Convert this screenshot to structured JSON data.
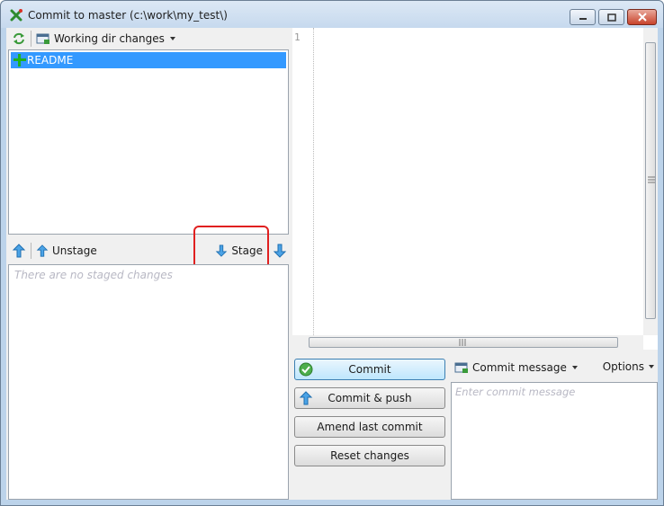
{
  "window": {
    "title": "Commit to master (c:\\work\\my_test\\)",
    "controls": [
      "minimize-icon",
      "maximize-icon",
      "close-icon"
    ]
  },
  "unstaged": {
    "dropdown_label": "Working dir changes",
    "files": [
      {
        "name": "README",
        "status_icon": "added-icon"
      }
    ]
  },
  "staged": {
    "unstage_label": "Unstage",
    "stage_label": "Stage",
    "empty_text": "There are no staged changes"
  },
  "diff": {
    "line_numbers": [
      "1"
    ]
  },
  "actions": {
    "commit": "Commit",
    "commit_push": "Commit & push",
    "amend": "Amend last commit",
    "reset": "Reset changes"
  },
  "message": {
    "dropdown_label": "Commit message",
    "options_label": "Options",
    "placeholder": "Enter commit message"
  },
  "colors": {
    "selection": "#3399ff",
    "highlight": "#e02020",
    "added": "#1fb11f"
  }
}
